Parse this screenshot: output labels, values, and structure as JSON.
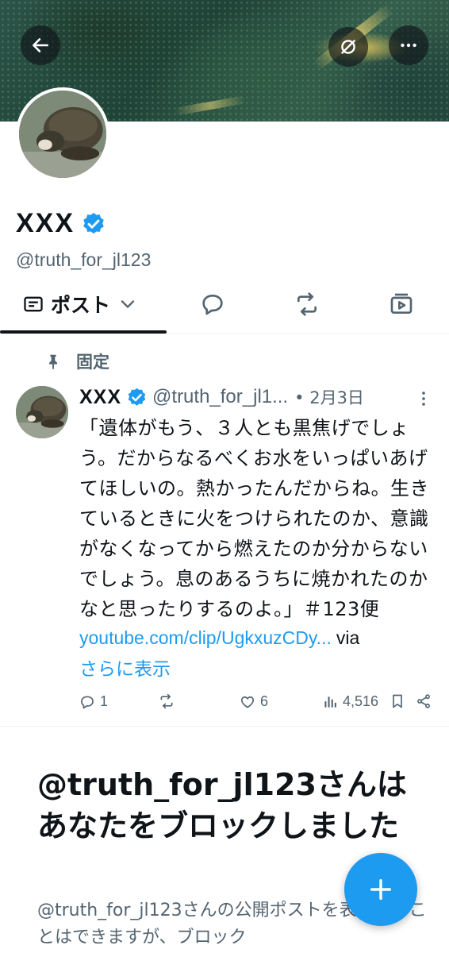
{
  "header": {
    "back_icon": "arrow-left-icon",
    "hide_icon": "eye-off-icon",
    "more_icon": "more-horizontal-icon"
  },
  "profile": {
    "display_name": "XXX",
    "handle": "@truth_for_jl123",
    "verified": true,
    "verified_color": "#1d9bf0"
  },
  "tabs": {
    "posts_label": "ポスト",
    "active": "posts",
    "icons": [
      "reply-icon",
      "repost-icon",
      "media-icon"
    ]
  },
  "pinned_post": {
    "pinned_label": "固定",
    "author_name": "XXX",
    "author_handle": "@truth_for_jl1...",
    "date": "• 2月3日",
    "text": "「遺体がもう、３人とも黒焦げでしょう。だからなるべくお水をいっぱいあげてほしいの。熱かったんだからね。生きているときに火をつけられたのか、意識がなくなってから燃えたのか分からないでしょう。息のあるうちに焼かれたのかなと思ったりするのよ。」＃123便",
    "link_url": "youtube.com/clip/UgkxuzCDy...",
    "link_via": "via",
    "show_more": "さらに表示",
    "stats": {
      "replies": "1",
      "reposts": "",
      "likes": "6",
      "views": "4,516"
    }
  },
  "blocked": {
    "title": "@truth_for_jl123さんはあなたをブロックしました",
    "description": "@truth_for_jl123さんの公開ポストを表示することはできますが、ブロック"
  },
  "fab": {
    "icon": "plus-icon",
    "color": "#1d9bf0"
  }
}
